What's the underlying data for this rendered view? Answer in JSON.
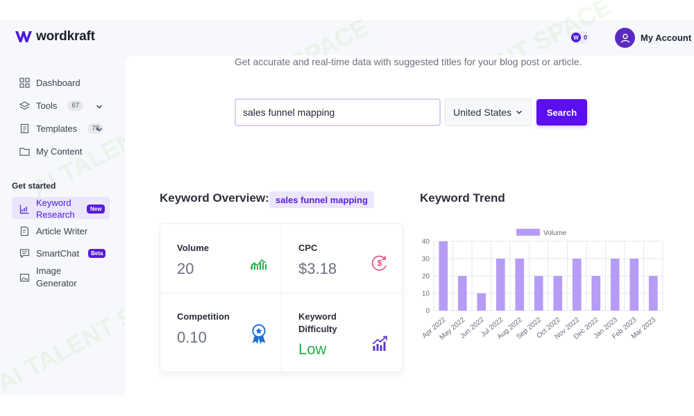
{
  "app": {
    "name": "wordkraft"
  },
  "header": {
    "credits_icon_letter": "W",
    "credits_count": "0",
    "account_label": "My Account"
  },
  "sidebar": {
    "items": [
      {
        "label": "Dashboard",
        "icon": "grid-icon"
      },
      {
        "label": "Tools",
        "count": "67",
        "icon": "layers-icon"
      },
      {
        "label": "Templates",
        "count": "78",
        "icon": "document-icon"
      },
      {
        "label": "My Content",
        "icon": "folder-icon"
      }
    ],
    "section_label": "Get started",
    "started_items": [
      {
        "label": "Keyword Research",
        "badge": "New",
        "icon": "chart-icon",
        "active": true
      },
      {
        "label": "Article Writer",
        "icon": "edit-doc-icon"
      },
      {
        "label": "SmartChat",
        "badge": "Beta",
        "icon": "chat-icon"
      },
      {
        "label": "Image Generator",
        "icon": "image-icon"
      }
    ]
  },
  "main": {
    "subtitle": "Get accurate and real-time data with suggested titles for your blog post or article.",
    "search": {
      "value": "sales funnel mapping",
      "country": "United States",
      "button_label": "Search"
    },
    "overview": {
      "title": "Keyword Overview:",
      "keyword": "sales funnel mapping",
      "metrics": {
        "volume": {
          "label": "Volume",
          "value": "20"
        },
        "cpc": {
          "label": "CPC",
          "value": "$3.18"
        },
        "competition": {
          "label": "Competition",
          "value": "0.10"
        },
        "difficulty": {
          "label": "Keyword Difficulty",
          "value": "Low"
        }
      }
    },
    "trend": {
      "title": "Keyword Trend"
    }
  },
  "colors": {
    "accent": "#5b0ff0",
    "bar": "#b69cf5",
    "success": "#22b14c",
    "brand": "#4c1bd6"
  },
  "watermark": "AI TALENT SPACE",
  "chart_data": {
    "type": "bar",
    "categories": [
      "Apr 2022",
      "May 2022",
      "Jun 2022",
      "Jul 2022",
      "Aug 2022",
      "Sep 2022",
      "Oct 2022",
      "Nov 2022",
      "Dec 2022",
      "Jan 2023",
      "Feb 2023",
      "Mar 2023"
    ],
    "series": [
      {
        "name": "Volume",
        "values": [
          40,
          20,
          10,
          30,
          30,
          20,
          20,
          30,
          20,
          30,
          30,
          20
        ]
      }
    ],
    "ylim": [
      0,
      40
    ],
    "yticks": [
      0,
      10,
      20,
      30,
      40
    ],
    "grid": true,
    "legend": "top"
  }
}
